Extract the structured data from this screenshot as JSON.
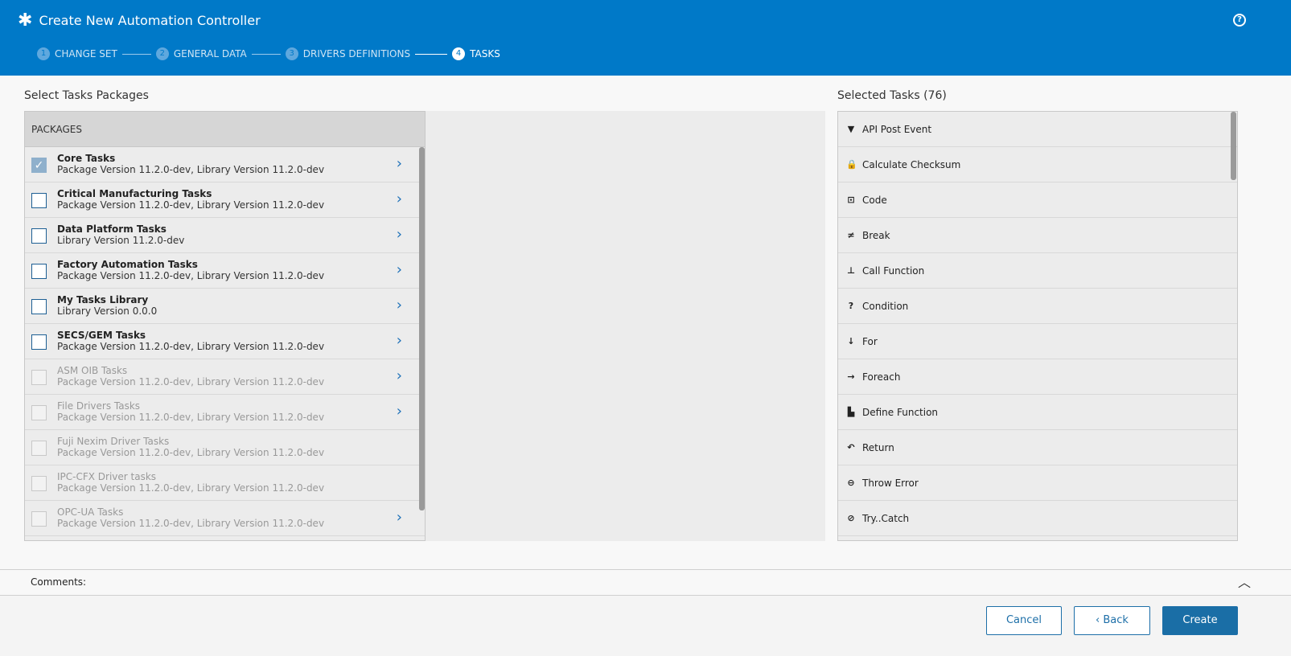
{
  "header": {
    "title": "Create New Automation Controller",
    "icon": "asterisk-icon",
    "help": "?"
  },
  "steps": [
    {
      "n": "1",
      "label": "CHANGE SET"
    },
    {
      "n": "2",
      "label": "GENERAL DATA"
    },
    {
      "n": "3",
      "label": "DRIVERS DEFINITIONS"
    },
    {
      "n": "4",
      "label": "TASKS"
    }
  ],
  "left": {
    "title": "Select Tasks Packages",
    "header": "PACKAGES",
    "packages": [
      {
        "name": "Core Tasks",
        "version": "Package Version 11.2.0-dev, Library Version 11.2.0-dev",
        "checked": true,
        "disabled": false,
        "arrow": true
      },
      {
        "name": "Critical Manufacturing Tasks",
        "version": "Package Version 11.2.0-dev, Library Version 11.2.0-dev",
        "checked": false,
        "disabled": false,
        "arrow": true
      },
      {
        "name": "Data Platform Tasks",
        "version": "Library Version 11.2.0-dev",
        "checked": false,
        "disabled": false,
        "arrow": true
      },
      {
        "name": "Factory Automation Tasks",
        "version": "Package Version 11.2.0-dev, Library Version 11.2.0-dev",
        "checked": false,
        "disabled": false,
        "arrow": true
      },
      {
        "name": "My Tasks Library",
        "version": "Library Version 0.0.0",
        "checked": false,
        "disabled": false,
        "arrow": true
      },
      {
        "name": "SECS/GEM Tasks",
        "version": "Package Version 11.2.0-dev, Library Version 11.2.0-dev",
        "checked": false,
        "disabled": false,
        "arrow": true
      },
      {
        "name": "ASM OIB Tasks",
        "version": "Package Version 11.2.0-dev, Library Version 11.2.0-dev",
        "checked": false,
        "disabled": true,
        "arrow": true
      },
      {
        "name": "File Drivers Tasks",
        "version": "Package Version 11.2.0-dev, Library Version 11.2.0-dev",
        "checked": false,
        "disabled": true,
        "arrow": true
      },
      {
        "name": "Fuji Nexim Driver Tasks",
        "version": "Package Version 11.2.0-dev, Library Version 11.2.0-dev",
        "checked": false,
        "disabled": true,
        "arrow": false
      },
      {
        "name": "IPC-CFX Driver tasks",
        "version": "Package Version 11.2.0-dev, Library Version 11.2.0-dev",
        "checked": false,
        "disabled": true,
        "arrow": false
      },
      {
        "name": "OPC-UA Tasks",
        "version": "Package Version 11.2.0-dev, Library Version 11.2.0-dev",
        "checked": false,
        "disabled": true,
        "arrow": true
      }
    ]
  },
  "right": {
    "title": "Selected Tasks (76)",
    "tasks": [
      {
        "label": "API Post Event",
        "icon": "api-event-icon",
        "glyph": "▼"
      },
      {
        "label": "Calculate Checksum",
        "icon": "lock-icon",
        "glyph": "🔒"
      },
      {
        "label": "Code",
        "icon": "terminal-icon",
        "glyph": "⊡"
      },
      {
        "label": "Break",
        "icon": "break-icon",
        "glyph": "≠"
      },
      {
        "label": "Call Function",
        "icon": "hierarchy-icon",
        "glyph": "⊥"
      },
      {
        "label": "Condition",
        "icon": "question-icon",
        "glyph": "?"
      },
      {
        "label": "For",
        "icon": "sort-icon",
        "glyph": "↓"
      },
      {
        "label": "Foreach",
        "icon": "foreach-icon",
        "glyph": "→"
      },
      {
        "label": "Define Function",
        "icon": "blocks-icon",
        "glyph": "▙"
      },
      {
        "label": "Return",
        "icon": "undo-icon",
        "glyph": "↶"
      },
      {
        "label": "Throw Error",
        "icon": "minus-circle-icon",
        "glyph": "⊖"
      },
      {
        "label": "Try..Catch",
        "icon": "try-catch-icon",
        "glyph": "⊘"
      }
    ]
  },
  "comments": {
    "label": "Comments:"
  },
  "footer": {
    "cancel": "Cancel",
    "back": "Back",
    "create": "Create"
  }
}
